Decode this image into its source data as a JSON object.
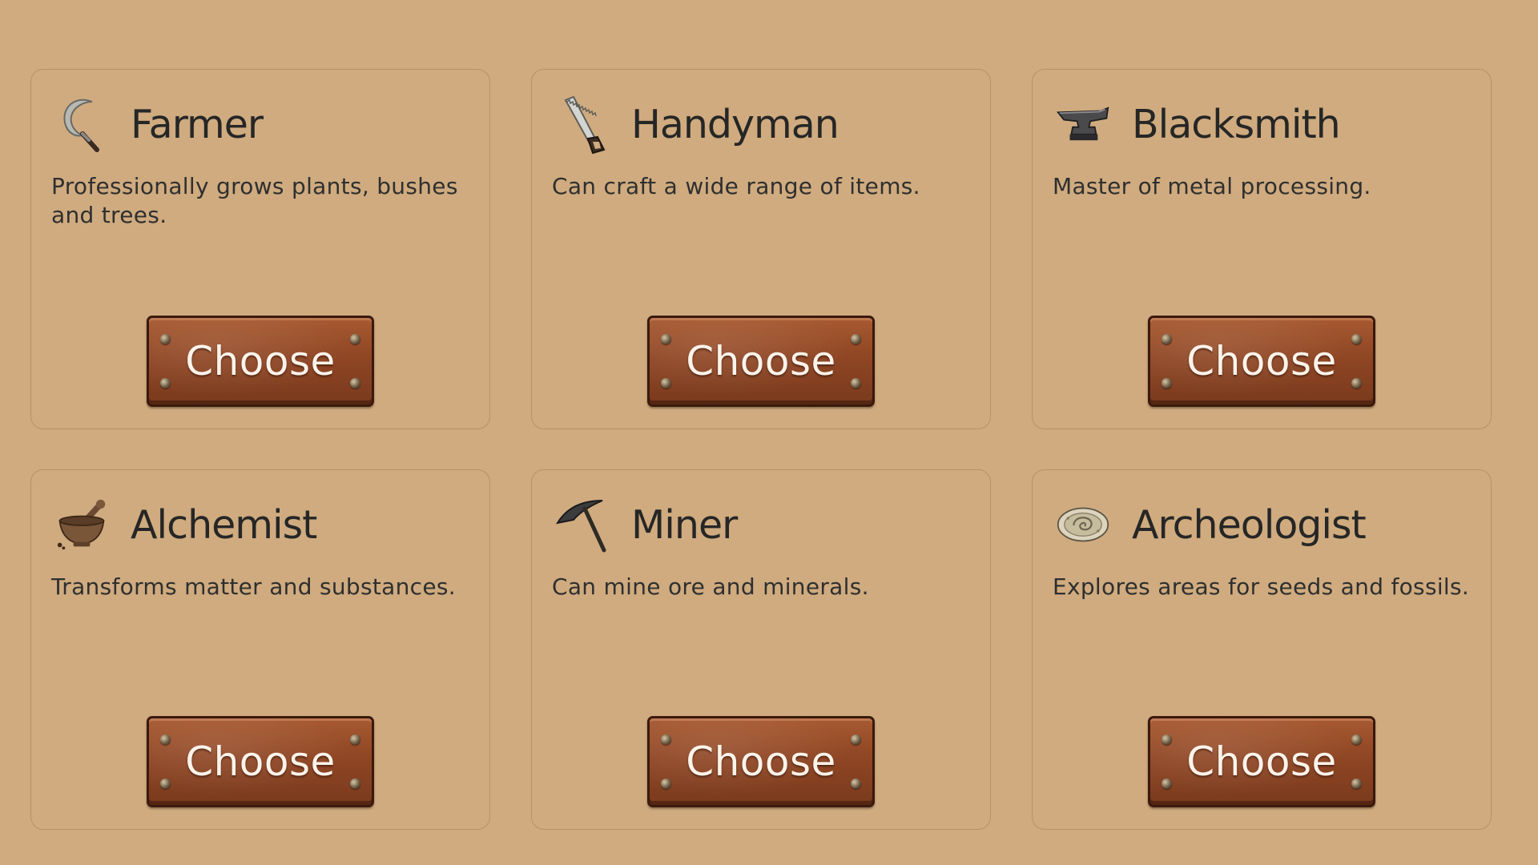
{
  "cards": [
    {
      "title": "Farmer",
      "description": "Professionally grows plants, bushes and trees.",
      "icon": "sickle-icon",
      "button_label": "Choose"
    },
    {
      "title": "Handyman",
      "description": "Can craft a wide range of items.",
      "icon": "saw-icon",
      "button_label": "Choose"
    },
    {
      "title": "Blacksmith",
      "description": "Master of metal processing.",
      "icon": "anvil-icon",
      "button_label": "Choose"
    },
    {
      "title": "Alchemist",
      "description": "Transforms matter and substances.",
      "icon": "mortar-pestle-icon",
      "button_label": "Choose"
    },
    {
      "title": "Miner",
      "description": "Can mine ore and minerals.",
      "icon": "pickaxe-icon",
      "button_label": "Choose"
    },
    {
      "title": "Archeologist",
      "description": "Explores areas for seeds and fossils.",
      "icon": "fossil-icon",
      "button_label": "Choose"
    }
  ],
  "colors": {
    "background": "#cfab7f",
    "card_border": "#b89266",
    "button_wood": "#8f4624",
    "button_text": "#fbf3ea",
    "title_text": "#262626"
  }
}
